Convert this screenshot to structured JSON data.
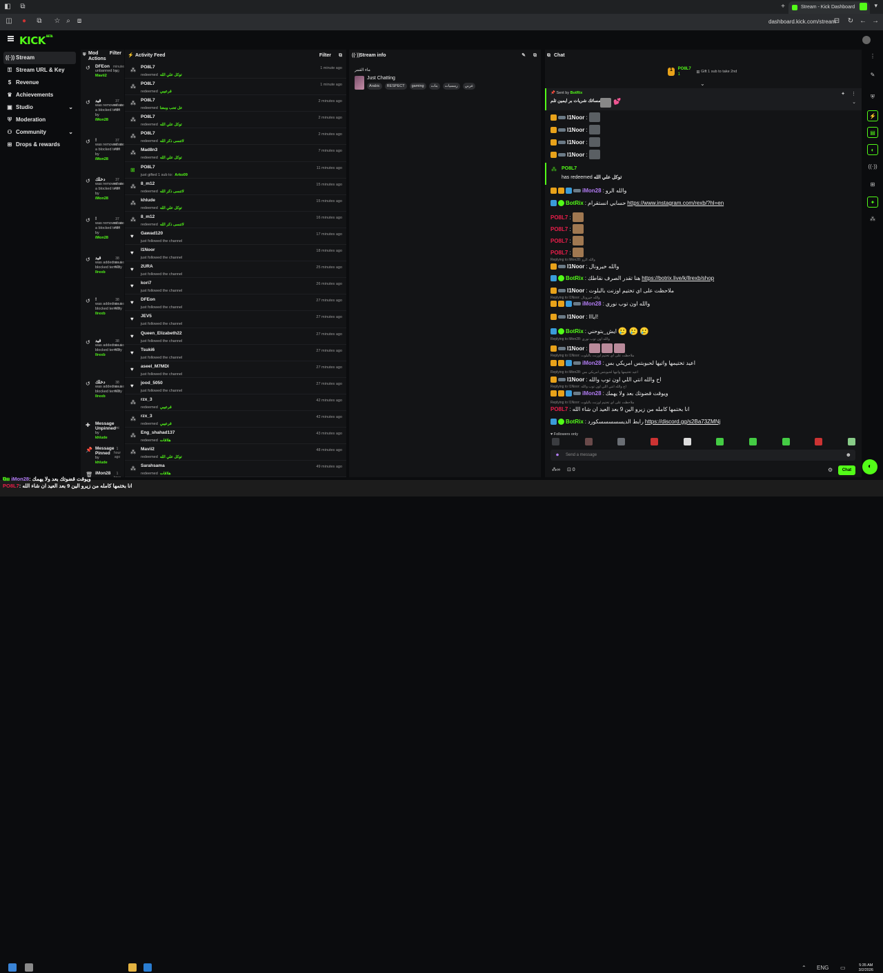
{
  "browser": {
    "tab_title": "Stream - Kick Dashboard",
    "url": "dashboard.kick.com/stream"
  },
  "brand": {
    "logo": "KICK",
    "logo_sup": "BETA",
    "accent": "#53fc18"
  },
  "sidebar": {
    "items": [
      {
        "label": "Stream",
        "icon": "broadcast-icon"
      },
      {
        "label": "Stream URL & Key",
        "icon": "key-icon"
      },
      {
        "label": "Revenue",
        "icon": "dollar-icon"
      },
      {
        "label": "Achievements",
        "icon": "trophy-icon"
      },
      {
        "label": "Studio",
        "icon": "studio-icon"
      },
      {
        "label": "Moderation",
        "icon": "shield-icon"
      },
      {
        "label": "Community",
        "icon": "community-icon"
      },
      {
        "label": "Drops & rewards",
        "icon": "gift-icon"
      }
    ]
  },
  "mod": {
    "title": "Mod Actions",
    "filter": "Filter",
    "rows": [
      {
        "name": "DFEon",
        "text": "unbanned by",
        "by": "Mavii2",
        "t1": "minutes",
        "t2": "ag"
      },
      {
        "name": "قيد",
        "text": "was removed as a blocked term by",
        "by": "iMon28",
        "t1": "37",
        "t2": "minutes ago"
      },
      {
        "name": "!",
        "text": "was removed as a blocked term by",
        "by": "iMon28",
        "t1": "37",
        "t2": "minutes ago"
      },
      {
        "name": "دخلك",
        "text": "was removed as a blocked term by",
        "by": "iMon28",
        "t1": "37",
        "t2": "minutes ago"
      },
      {
        "name": "!",
        "text": "was removed as a blocked term by",
        "by": "iMon28",
        "t1": "37",
        "t2": "minutes ago"
      },
      {
        "name": "قيد",
        "text": "was added as a blocked term by",
        "by": "llrexb",
        "t1": "38",
        "t2": "minutes ago"
      },
      {
        "name": "!",
        "text": "was added as a blocked term by",
        "by": "llrexb",
        "t1": "38",
        "t2": "minutes ago"
      },
      {
        "name": "قيد",
        "text": "was added as a blocked term by",
        "by": "llrexb",
        "t1": "38",
        "t2": "minutes ago"
      },
      {
        "name": "دخلك",
        "text": "was added as a blocked term by",
        "by": "llrexb",
        "t1": "38",
        "t2": "minutes ago"
      },
      {
        "name": "Message Unpinned",
        "text": "by",
        "by": "khlude",
        "t1": "",
        "t2": "mi"
      },
      {
        "name": "Message Pinned",
        "text": "by",
        "by": "khlude",
        "t1": "1",
        "t2": "hour ago"
      },
      {
        "name": "iMon28",
        "text": "",
        "by": "",
        "t1": "1",
        "t2": "hour ago"
      }
    ]
  },
  "activity": {
    "title": "Activity Feed",
    "filter": "Filter",
    "rows": [
      {
        "user": "PO8L7",
        "status": "redeemed",
        "reward": "توكل علي الله",
        "time": "1 minute ago",
        "icon": "redeem-icon"
      },
      {
        "user": "PO8L7",
        "status": "redeemed",
        "reward": "قرعيبي",
        "time": "1 minute ago",
        "icon": "redeem-icon"
      },
      {
        "user": "PO8L7",
        "status": "redeemed",
        "reward": "عل تحب ومعنا",
        "time": "2 minutes ago",
        "icon": "redeem-icon"
      },
      {
        "user": "PO8L7",
        "status": "redeemed",
        "reward": "توكل علي الله",
        "time": "2 minutes ago",
        "icon": "redeem-icon"
      },
      {
        "user": "PO8L7",
        "status": "redeemed",
        "reward": "لاتنسى ذكر الله",
        "time": "2 minutes ago",
        "icon": "redeem-icon"
      },
      {
        "user": "Mad8n3",
        "status": "redeemed",
        "reward": "توكل علي الله",
        "time": "7 minutes ago",
        "icon": "redeem-icon"
      },
      {
        "user": "PO8L7",
        "status": "just gifted 1 sub to:",
        "reward": "Arko09",
        "time": "11 minutes ago",
        "icon": "gift-icon"
      },
      {
        "user": "8_m12",
        "status": "redeemed",
        "reward": "لاتنسى ذكر الله",
        "time": "15 minutes ago",
        "icon": "redeem-icon"
      },
      {
        "user": "khlude",
        "status": "redeemed",
        "reward": "توكل علي الله",
        "time": "15 minutes ago",
        "icon": "redeem-icon"
      },
      {
        "user": "8_m12",
        "status": "redeemed",
        "reward": "لاتنسى ذكر الله",
        "time": "16 minutes ago",
        "icon": "redeem-icon"
      },
      {
        "user": "Gawad120",
        "status": "just followed the channel",
        "reward": "",
        "time": "17 minutes ago",
        "icon": "heart-icon"
      },
      {
        "user": "I1Noor",
        "status": "just followed the channel",
        "reward": "",
        "time": "18 minutes ago",
        "icon": "heart-icon"
      },
      {
        "user": "2URA",
        "status": "just followed the channel",
        "reward": "",
        "time": "25 minutes ago",
        "icon": "heart-icon"
      },
      {
        "user": "kori7",
        "status": "just followed the channel",
        "reward": "",
        "time": "26 minutes ago",
        "icon": "heart-icon"
      },
      {
        "user": "DFEon",
        "status": "just followed the channel",
        "reward": "",
        "time": "27 minutes ago",
        "icon": "heart-icon"
      },
      {
        "user": "JEV5",
        "status": "just followed the channel",
        "reward": "",
        "time": "27 minutes ago",
        "icon": "heart-icon"
      },
      {
        "user": "Queen_Elizabeth22",
        "status": "just followed the channel",
        "reward": "",
        "time": "27 minutes ago",
        "icon": "heart-icon"
      },
      {
        "user": "Tsuki6",
        "status": "just followed the channel",
        "reward": "",
        "time": "27 minutes ago",
        "icon": "heart-icon"
      },
      {
        "user": "aseel_M7MDI",
        "status": "just followed the channel",
        "reward": "",
        "time": "27 minutes ago",
        "icon": "heart-icon"
      },
      {
        "user": "jood_5050",
        "status": "just followed the channel",
        "reward": "",
        "time": "27 minutes ago",
        "icon": "heart-icon"
      },
      {
        "user": "rzx_3",
        "status": "redeemed",
        "reward": "قرعيبي",
        "time": "42 minutes ago",
        "icon": "redeem-icon"
      },
      {
        "user": "rzx_3",
        "status": "redeemed",
        "reward": "قرعيبي",
        "time": "42 minutes ago",
        "icon": "redeem-icon"
      },
      {
        "user": "Eng_shahad137",
        "status": "redeemed",
        "reward": "هلاقات",
        "time": "43 minutes ago",
        "icon": "redeem-icon"
      },
      {
        "user": "Mavii2",
        "status": "redeemed",
        "reward": "توكل علي الله",
        "time": "48 minutes ago",
        "icon": "redeem-icon"
      },
      {
        "user": "Sarahsama",
        "status": "redeemed",
        "reward": "هلاقات",
        "time": "49 minutes ago",
        "icon": "redeem-icon"
      }
    ]
  },
  "info": {
    "title": "Stream info",
    "stream_title": "ماء القمر",
    "category": "Just Chatting",
    "tags": [
      "Arabic",
      "RESPECT",
      "gaming",
      "بنات",
      "رمسيات",
      "عربي"
    ]
  },
  "chat": {
    "title": "Chat",
    "top_gifter": {
      "rank": "1",
      "name": "PO8L7",
      "count": "1",
      "gift_cta": "Gift 1 sub to take 2nd"
    },
    "pinned": {
      "label": "Sent by",
      "by": "BotRix",
      "text": "ويبه مسائك شريات بر ايمين ثلم"
    },
    "redeem": {
      "user": "PO8L7",
      "text": "has redeemed",
      "reward": "توكل علي الله"
    },
    "followers_only": "Followers only",
    "placeholder": "Send a message",
    "send": "Chat",
    "footer_count": "0",
    "messages": [
      {
        "user": "I1Noor",
        "color": "#f5f5f5",
        "text": "",
        "emotes": 1
      },
      {
        "user": "I1Noor",
        "color": "#f5f5f5",
        "text": "",
        "emotes": 1
      },
      {
        "user": "I1Noor",
        "color": "#f5f5f5",
        "text": "",
        "emotes": 1
      },
      {
        "user": "I1Noor",
        "color": "#f5f5f5",
        "text": "",
        "emotes": 1
      },
      {
        "user": "iMon28",
        "color": "#b27cf4",
        "text": "والله الرو",
        "emotes": 0
      },
      {
        "user": "BotRix",
        "color": "#53fc18",
        "text": "حسابي انستقرام",
        "link": "https://www.instagram.com/rexb/?hl=en"
      },
      {
        "user": "PO8L7",
        "color": "#e91e4a",
        "text": "",
        "emotes": 2
      },
      {
        "user": "PO8L7",
        "color": "#e91e4a",
        "text": "",
        "emotes": 2
      },
      {
        "user": "PO8L7",
        "color": "#e91e4a",
        "text": "",
        "emotes": 2
      },
      {
        "user": "PO8L7",
        "color": "#e91e4a",
        "text": "",
        "emotes": 2
      },
      {
        "user": "I1Noor",
        "color": "#f5f5f5",
        "text": "والله خيرونال",
        "reply": "Replying to iMon28: والله الرو"
      },
      {
        "user": "BotRix",
        "color": "#53fc18",
        "text": "هنا تقدر الصرف نقاطك",
        "link": "https://botrix.live/k/llrexb/shop"
      },
      {
        "user": "I1Noor",
        "color": "#f5f5f5",
        "text": "ملاحظت على اي تختيم اوزنت بالبلوت"
      },
      {
        "user": "iMon28",
        "color": "#b27cf4",
        "text": "والله اون توب نوري",
        "reply": "Replying to I1Noor: والله خيرونال"
      },
      {
        "user": "I1Noor",
        "color": "#f5f5f5",
        "text": "ايااا!"
      },
      {
        "user": "BotRix",
        "color": "#53fc18",
        "text": "ايش_بتوحني"
      },
      {
        "user": "I1Noor",
        "color": "#f5f5f5",
        "text": "",
        "reply": "Replying to iMon28: والله اون توب نوري",
        "emotes": 3
      },
      {
        "user": "iMon28",
        "color": "#b27cf4",
        "text": "اعيد تختيمها واتيها لحبوبتس امريكي بس",
        "reply": "Replying to I1Noor: ملاحظت على اي تختيم اوزنت بالبلوت"
      },
      {
        "user": "I1Noor",
        "color": "#f5f5f5",
        "text": "اح والله انتي اللي اون توب والله",
        "reply": "Replying to iMon28: اعيد تختيمها واتيها لحبوبتس امريكي بس"
      },
      {
        "user": "iMon28",
        "color": "#b27cf4",
        "text": "ويوقت قضوتك بعد ولا يهمك",
        "reply": "Replying to I1Noor: اح والله انتي اللي اون توب والله"
      },
      {
        "user": "PO8L7",
        "color": "#e91e4a",
        "text": "انا بختمها كامله من زيرو الين 9 بعد العيد ان شاء الله",
        "reply": "Replying to I1Noor: ملاحظت على اي تختيم اوزنت بالبلوت"
      },
      {
        "user": "BotRix",
        "color": "#53fc18",
        "text": "رابط الديسسسسسكورد",
        "link": "https://discord.gg/s2Ba73ZMNj"
      }
    ]
  },
  "overlay": {
    "line1_user": "iMon28",
    "line1_text": "ويوقت قضوتك بعد ولا يهمك",
    "line2_user": "PO8L7",
    "line2_text": "انا بختمها كامله من زيرو الين 9 بعد العيد ان شاء الله"
  },
  "clock": {
    "time": "5:35 AM",
    "date": "3/2/2026"
  }
}
